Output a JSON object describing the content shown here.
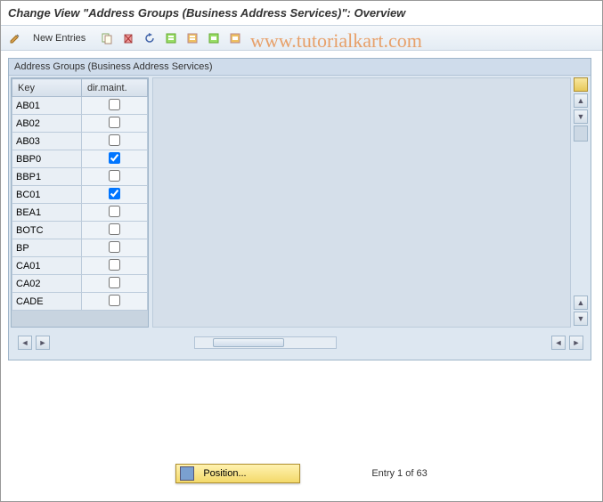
{
  "title": "Change View \"Address Groups (Business Address Services)\": Overview",
  "toolbar": {
    "new_entries": "New Entries"
  },
  "panel_title": "Address Groups (Business Address Services)",
  "columns": {
    "key": "Key",
    "dirmaint": "dir.maint."
  },
  "rows": [
    {
      "key": "AB01",
      "dirmaint": false
    },
    {
      "key": "AB02",
      "dirmaint": false
    },
    {
      "key": "AB03",
      "dirmaint": false
    },
    {
      "key": "BBP0",
      "dirmaint": true
    },
    {
      "key": "BBP1",
      "dirmaint": false
    },
    {
      "key": "BC01",
      "dirmaint": true
    },
    {
      "key": "BEA1",
      "dirmaint": false
    },
    {
      "key": "BOTC",
      "dirmaint": false
    },
    {
      "key": "BP",
      "dirmaint": false
    },
    {
      "key": "CA01",
      "dirmaint": false
    },
    {
      "key": "CA02",
      "dirmaint": false
    },
    {
      "key": "CADE",
      "dirmaint": false
    }
  ],
  "footer": {
    "position_label": "Position...",
    "entry_text": "Entry 1 of 63"
  },
  "watermark": "www.tutorialkart.com"
}
